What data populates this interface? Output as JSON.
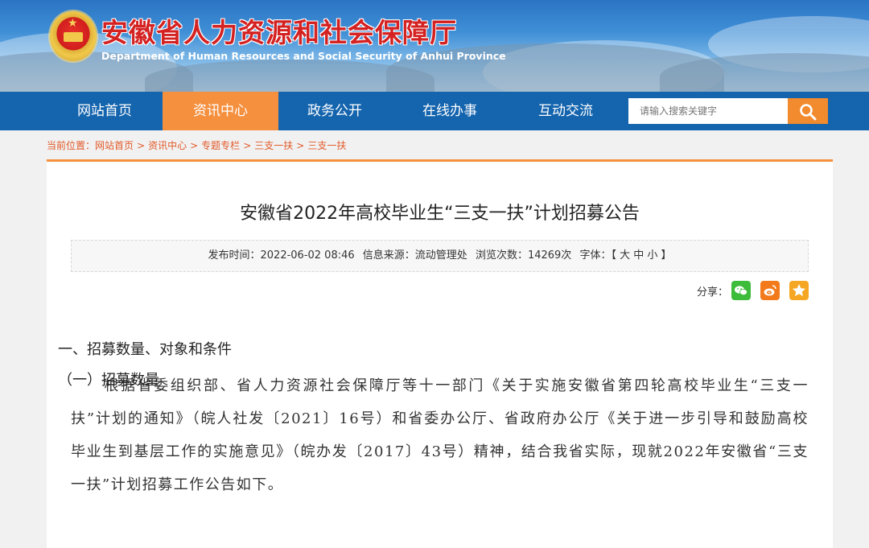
{
  "header": {
    "title": "安徽省人力资源和社会保障厅",
    "subtitle": "Department of Human Resources and Social Security of Anhui Province",
    "emblem": "national-emblem"
  },
  "nav": {
    "items": [
      {
        "label": "网站首页"
      },
      {
        "label": "资讯中心"
      },
      {
        "label": "政务公开"
      },
      {
        "label": "在线办事"
      },
      {
        "label": "互动交流"
      }
    ],
    "active_index": 1,
    "search_placeholder": "请输入搜索关键字",
    "search_icon": "search-icon"
  },
  "breadcrumb": {
    "prefix": "当前位置：",
    "items": [
      "网站首页",
      "资讯中心",
      "专题专栏",
      "三支一扶",
      "三支一扶"
    ],
    "separator": ">"
  },
  "article": {
    "title": "安徽省2022年高校毕业生“三支一扶”计划招募公告",
    "meta": {
      "publish_time": "发布时间：2022-06-02 08:46",
      "source": "信息来源：流动管理处",
      "views": "浏览次数：14269次",
      "font_size": "字体：【 大 中 小 】"
    },
    "share_label": "分享：",
    "share_icons": [
      "wechat-icon",
      "weibo-icon",
      "favorite-icon"
    ],
    "paragraph": "根据省委组织部、省人力资源社会保障厅等十一部门《关于实施安徽省第四轮高校毕业生“三支一扶”计划的通知》（皖人社发〔2021〕16号）和省委办公厅、省政府办公厅《关于进一步引导和鼓励高校毕业生到基层工作的实施意见》（皖办发〔2017〕43号）精神，结合我省实际，现就2022年安徽省“三支一扶”计划招募工作公告如下。",
    "heading1": "一、招募数量、对象和条件",
    "heading2": "（一）招募数量"
  },
  "colors": {
    "nav_bg": "#1464ae",
    "nav_active": "#f5903f",
    "title_red": "#d42121",
    "wechat": "#3dbb3a",
    "weibo": "#f27a1a",
    "favorite": "#f5a623"
  }
}
